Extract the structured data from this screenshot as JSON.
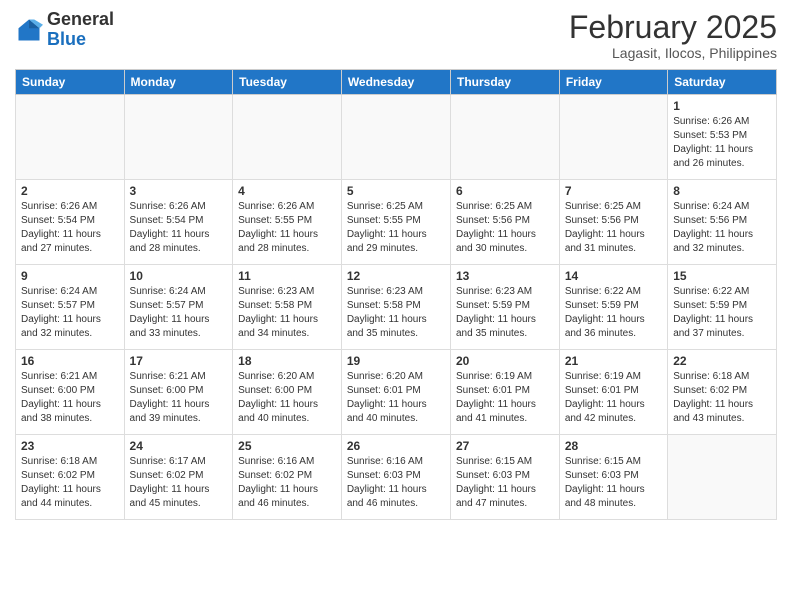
{
  "header": {
    "logo_general": "General",
    "logo_blue": "Blue",
    "month_title": "February 2025",
    "location": "Lagasit, Ilocos, Philippines"
  },
  "days_of_week": [
    "Sunday",
    "Monday",
    "Tuesday",
    "Wednesday",
    "Thursday",
    "Friday",
    "Saturday"
  ],
  "weeks": [
    {
      "days": [
        {
          "num": "",
          "info": ""
        },
        {
          "num": "",
          "info": ""
        },
        {
          "num": "",
          "info": ""
        },
        {
          "num": "",
          "info": ""
        },
        {
          "num": "",
          "info": ""
        },
        {
          "num": "",
          "info": ""
        },
        {
          "num": "1",
          "info": "Sunrise: 6:26 AM\nSunset: 5:53 PM\nDaylight: 11 hours and 26 minutes."
        }
      ]
    },
    {
      "days": [
        {
          "num": "2",
          "info": "Sunrise: 6:26 AM\nSunset: 5:54 PM\nDaylight: 11 hours and 27 minutes."
        },
        {
          "num": "3",
          "info": "Sunrise: 6:26 AM\nSunset: 5:54 PM\nDaylight: 11 hours and 28 minutes."
        },
        {
          "num": "4",
          "info": "Sunrise: 6:26 AM\nSunset: 5:55 PM\nDaylight: 11 hours and 28 minutes."
        },
        {
          "num": "5",
          "info": "Sunrise: 6:25 AM\nSunset: 5:55 PM\nDaylight: 11 hours and 29 minutes."
        },
        {
          "num": "6",
          "info": "Sunrise: 6:25 AM\nSunset: 5:56 PM\nDaylight: 11 hours and 30 minutes."
        },
        {
          "num": "7",
          "info": "Sunrise: 6:25 AM\nSunset: 5:56 PM\nDaylight: 11 hours and 31 minutes."
        },
        {
          "num": "8",
          "info": "Sunrise: 6:24 AM\nSunset: 5:56 PM\nDaylight: 11 hours and 32 minutes."
        }
      ]
    },
    {
      "days": [
        {
          "num": "9",
          "info": "Sunrise: 6:24 AM\nSunset: 5:57 PM\nDaylight: 11 hours and 32 minutes."
        },
        {
          "num": "10",
          "info": "Sunrise: 6:24 AM\nSunset: 5:57 PM\nDaylight: 11 hours and 33 minutes."
        },
        {
          "num": "11",
          "info": "Sunrise: 6:23 AM\nSunset: 5:58 PM\nDaylight: 11 hours and 34 minutes."
        },
        {
          "num": "12",
          "info": "Sunrise: 6:23 AM\nSunset: 5:58 PM\nDaylight: 11 hours and 35 minutes."
        },
        {
          "num": "13",
          "info": "Sunrise: 6:23 AM\nSunset: 5:59 PM\nDaylight: 11 hours and 35 minutes."
        },
        {
          "num": "14",
          "info": "Sunrise: 6:22 AM\nSunset: 5:59 PM\nDaylight: 11 hours and 36 minutes."
        },
        {
          "num": "15",
          "info": "Sunrise: 6:22 AM\nSunset: 5:59 PM\nDaylight: 11 hours and 37 minutes."
        }
      ]
    },
    {
      "days": [
        {
          "num": "16",
          "info": "Sunrise: 6:21 AM\nSunset: 6:00 PM\nDaylight: 11 hours and 38 minutes."
        },
        {
          "num": "17",
          "info": "Sunrise: 6:21 AM\nSunset: 6:00 PM\nDaylight: 11 hours and 39 minutes."
        },
        {
          "num": "18",
          "info": "Sunrise: 6:20 AM\nSunset: 6:00 PM\nDaylight: 11 hours and 40 minutes."
        },
        {
          "num": "19",
          "info": "Sunrise: 6:20 AM\nSunset: 6:01 PM\nDaylight: 11 hours and 40 minutes."
        },
        {
          "num": "20",
          "info": "Sunrise: 6:19 AM\nSunset: 6:01 PM\nDaylight: 11 hours and 41 minutes."
        },
        {
          "num": "21",
          "info": "Sunrise: 6:19 AM\nSunset: 6:01 PM\nDaylight: 11 hours and 42 minutes."
        },
        {
          "num": "22",
          "info": "Sunrise: 6:18 AM\nSunset: 6:02 PM\nDaylight: 11 hours and 43 minutes."
        }
      ]
    },
    {
      "days": [
        {
          "num": "23",
          "info": "Sunrise: 6:18 AM\nSunset: 6:02 PM\nDaylight: 11 hours and 44 minutes."
        },
        {
          "num": "24",
          "info": "Sunrise: 6:17 AM\nSunset: 6:02 PM\nDaylight: 11 hours and 45 minutes."
        },
        {
          "num": "25",
          "info": "Sunrise: 6:16 AM\nSunset: 6:02 PM\nDaylight: 11 hours and 46 minutes."
        },
        {
          "num": "26",
          "info": "Sunrise: 6:16 AM\nSunset: 6:03 PM\nDaylight: 11 hours and 46 minutes."
        },
        {
          "num": "27",
          "info": "Sunrise: 6:15 AM\nSunset: 6:03 PM\nDaylight: 11 hours and 47 minutes."
        },
        {
          "num": "28",
          "info": "Sunrise: 6:15 AM\nSunset: 6:03 PM\nDaylight: 11 hours and 48 minutes."
        },
        {
          "num": "",
          "info": ""
        }
      ]
    }
  ]
}
